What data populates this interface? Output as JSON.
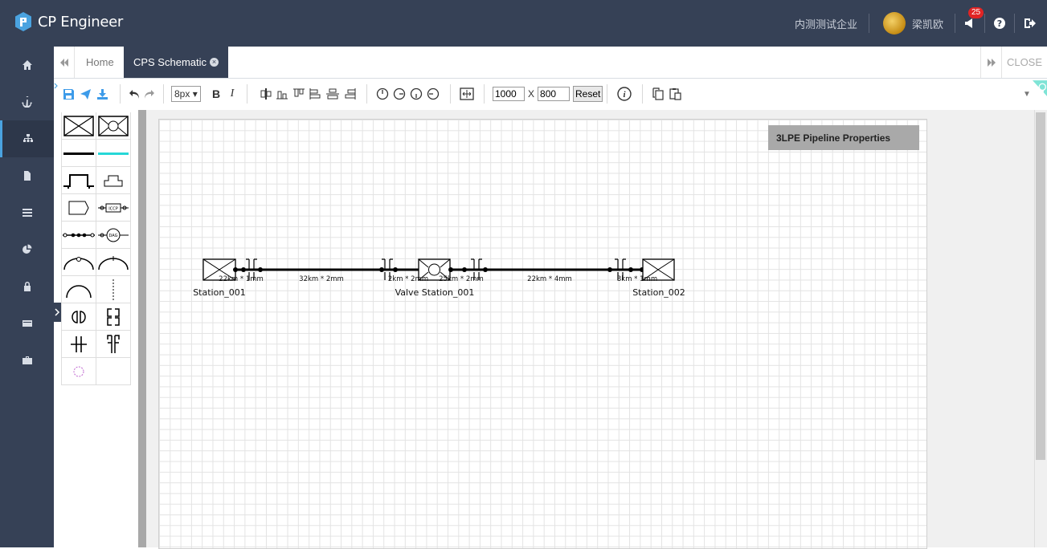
{
  "app": {
    "title": "CP Engineer"
  },
  "header": {
    "company": "内测测试企业",
    "username": "梁凯欧",
    "notification_count": "25"
  },
  "sidebar": {
    "items": [
      {
        "icon": "home-icon"
      },
      {
        "icon": "anchor-icon"
      },
      {
        "icon": "sitemap-icon",
        "active": true
      },
      {
        "icon": "document-icon"
      },
      {
        "icon": "list-icon"
      },
      {
        "icon": "pie-chart-icon"
      },
      {
        "icon": "lock-icon"
      },
      {
        "icon": "card-icon"
      },
      {
        "icon": "briefcase-icon"
      }
    ]
  },
  "tabs": {
    "home_label": "Home",
    "active_label": "CPS Schematic",
    "close_label": "CLOSE"
  },
  "toolbar": {
    "font_size": "8px",
    "bold_label": "B",
    "italic_label": "I",
    "width_value": "1000",
    "times_label": "X",
    "height_value": "800",
    "reset_label": "Reset"
  },
  "canvas": {
    "properties_label": "3LPE Pipeline Properties",
    "stations": [
      "Station_001",
      "Valve Station_001",
      "Station_002"
    ],
    "segments": [
      "22km * 1mm",
      "32km * 2mm",
      "2km * 2mm",
      "25km * 2mm",
      "22km * 4mm",
      "3km * 1mm"
    ]
  },
  "colors": {
    "dark": "#364156",
    "accent": "#4aa3e0",
    "cyan": "#26d7d7"
  }
}
